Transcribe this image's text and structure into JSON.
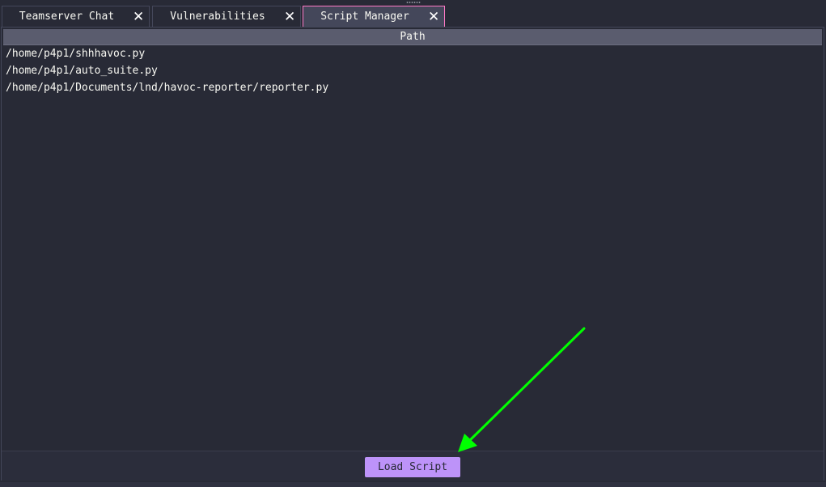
{
  "tabs": [
    {
      "label": "Teamserver Chat",
      "close": "✕",
      "active": false
    },
    {
      "label": "Vulnerabilities",
      "close": "✕",
      "active": false
    },
    {
      "label": "Script Manager",
      "close": "✕",
      "active": true
    }
  ],
  "table": {
    "header": "Path",
    "rows": [
      "/home/p4p1/shhhavoc.py",
      "/home/p4p1/auto_suite.py",
      "/home/p4p1/Documents/lnd/havoc-reporter/reporter.py"
    ]
  },
  "actions": {
    "load_script_label": "Load Script"
  },
  "colors": {
    "background": "#282a36",
    "active_tab_border": "#ff79c6",
    "button": "#bd93f9",
    "annotation_arrow": "#00ff00"
  },
  "icons": {
    "tab_close": "close-icon",
    "splitter": "drag-handle-icon",
    "annotation": "arrow-icon"
  }
}
